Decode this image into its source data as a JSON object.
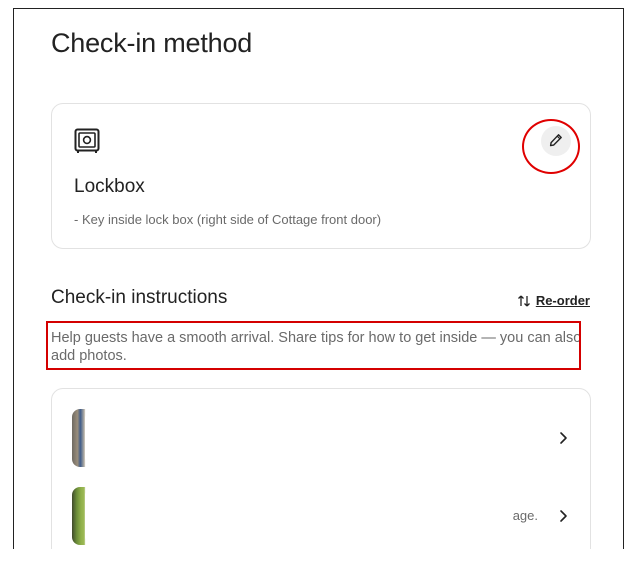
{
  "page": {
    "title": "Check-in method"
  },
  "method_card": {
    "icon": "lockbox-icon",
    "title": "Lockbox",
    "description": "- Key inside lock box (right side of Cottage front door)",
    "edit_icon": "pencil-icon"
  },
  "instructions": {
    "title": "Check-in instructions",
    "reorder_label": "Re-order",
    "reorder_icon": "reorder-icon",
    "helper": "Help guests have a smooth arrival. Share tips for how to get inside — you can also add photos.",
    "items": [
      {
        "snippet": "",
        "chevron": "chevron-right-icon"
      },
      {
        "snippet": "age.",
        "chevron": "chevron-right-icon"
      }
    ]
  },
  "annotations": {
    "highlight_color": "#e00000"
  }
}
